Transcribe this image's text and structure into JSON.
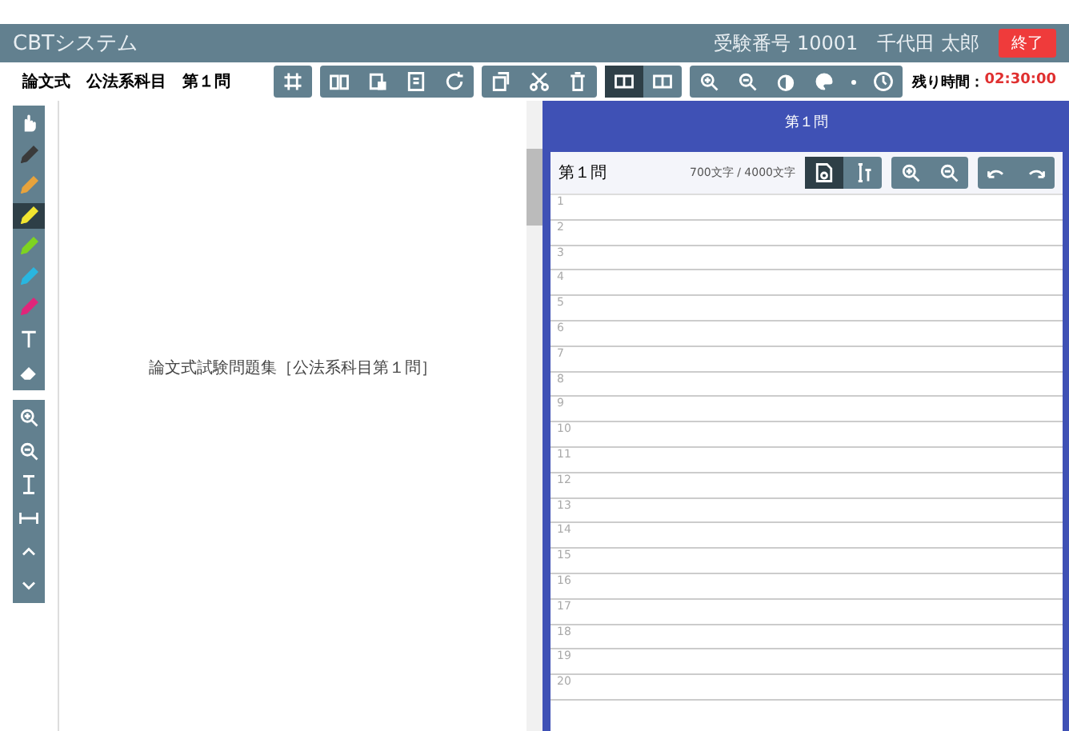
{
  "header": {
    "title": "CBTシステム",
    "examinee_number": "受験番号 10001",
    "user_name": "千代田 太郎",
    "exit_button": "終了"
  },
  "subheader": {
    "breadcrumb": [
      "論文式",
      "公法系科目",
      "第１問"
    ],
    "time_label": "残り時間：",
    "time_value": "02:30:00"
  },
  "toolbar": [
    [
      {
        "kind": "grid",
        "selected": false
      }
    ],
    [
      {
        "kind": "book",
        "selected": false
      },
      {
        "kind": "paste",
        "selected": false
      },
      {
        "kind": "note",
        "selected": false
      },
      {
        "kind": "refresh",
        "selected": false
      }
    ],
    [
      {
        "kind": "copy",
        "selected": false
      },
      {
        "kind": "cut",
        "selected": false
      },
      {
        "kind": "trash",
        "selected": false
      }
    ],
    [
      {
        "kind": "panel",
        "selected": true
      },
      {
        "kind": "panel",
        "selected": false
      }
    ],
    [
      {
        "kind": "zoom-in",
        "selected": false
      },
      {
        "kind": "zoom-out",
        "selected": false
      },
      {
        "kind": "contrast",
        "selected": false
      },
      {
        "kind": "palette",
        "selected": false
      },
      {
        "kind": "blank",
        "selected": false
      },
      {
        "kind": "clock",
        "selected": false
      }
    ]
  ],
  "pen_tools": [
    {
      "kind": "hand",
      "selected": false
    },
    {
      "kind": "pen",
      "color": "#3a3a3a",
      "selected": false
    },
    {
      "kind": "pen",
      "color": "#e8a33c",
      "selected": false
    },
    {
      "kind": "pen",
      "color": "#f2e530",
      "selected": true
    },
    {
      "kind": "pen",
      "color": "#7ed321",
      "selected": false
    },
    {
      "kind": "pen",
      "color": "#29b6e0",
      "selected": false
    },
    {
      "kind": "pen",
      "color": "#e0267a",
      "selected": false
    },
    {
      "kind": "text",
      "selected": false
    },
    {
      "kind": "eraser",
      "selected": false
    }
  ],
  "view_tools": [
    {
      "kind": "zoom-in"
    },
    {
      "kind": "zoom-out"
    },
    {
      "kind": "fit-height"
    },
    {
      "kind": "fit-width"
    },
    {
      "kind": "up"
    },
    {
      "kind": "down"
    }
  ],
  "document": {
    "title": "論文式試験問題集［公法系科目第１問］"
  },
  "answer": {
    "tab": "第１問",
    "title": "第１問",
    "count": "700文字 / 4000文字",
    "tools": [
      [
        {
          "kind": "doc",
          "selected": true
        },
        {
          "kind": "cursor",
          "selected": false
        }
      ],
      [
        {
          "kind": "zoom-in",
          "selected": false
        },
        {
          "kind": "zoom-out",
          "selected": false
        }
      ],
      [
        {
          "kind": "undo",
          "selected": false
        },
        {
          "kind": "redo",
          "selected": false
        }
      ]
    ],
    "line_numbers": [
      "1",
      "2",
      "3",
      "4",
      "5",
      "6",
      "7",
      "8",
      "9",
      "10",
      "11",
      "12",
      "13",
      "14",
      "15",
      "16",
      "17",
      "18",
      "19",
      "20"
    ]
  }
}
